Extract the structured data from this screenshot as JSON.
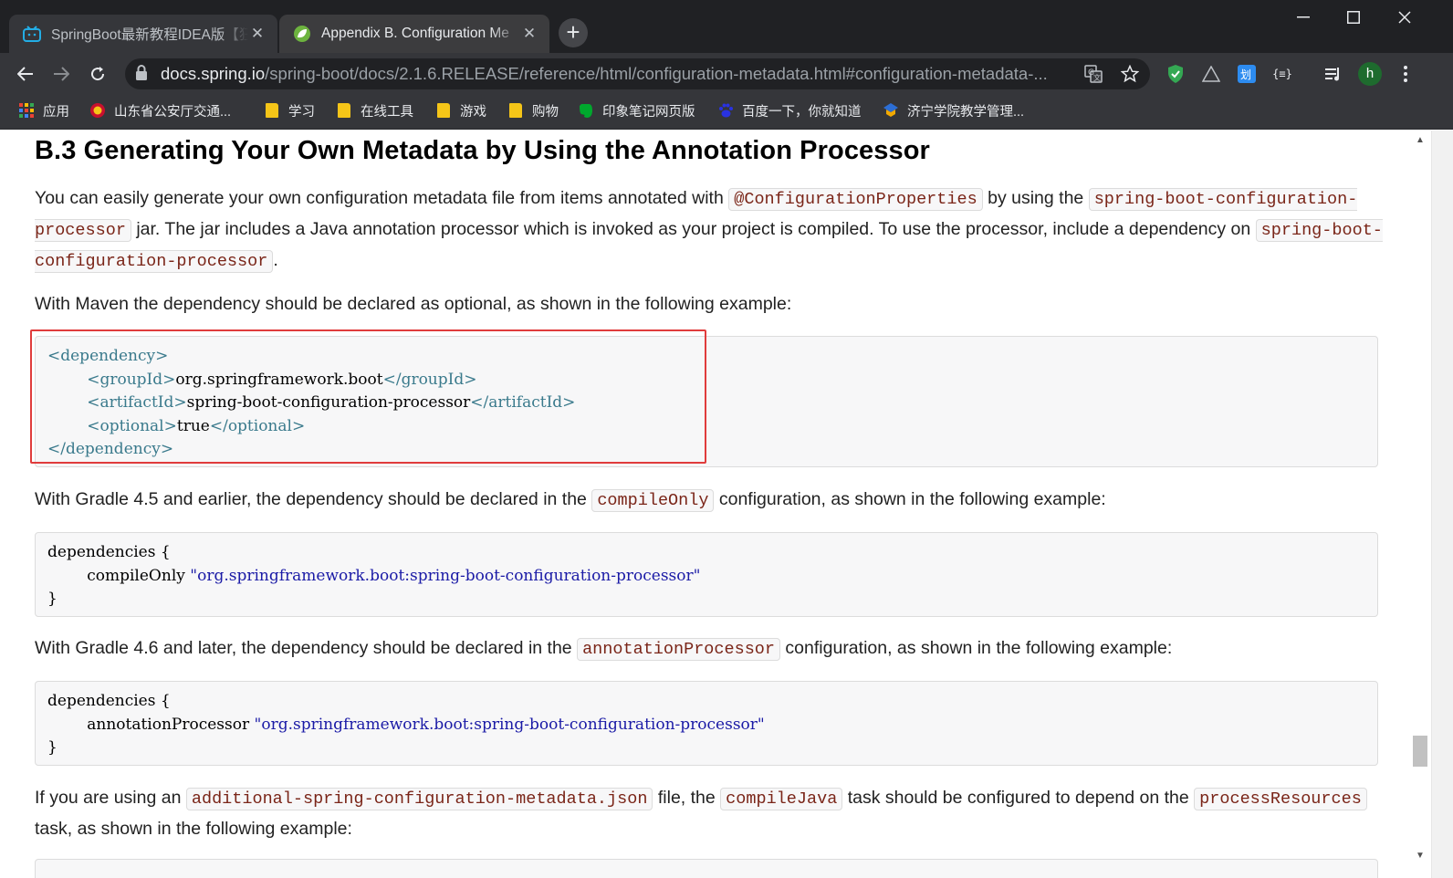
{
  "browser": {
    "tabs": [
      {
        "title": "SpringBoot最新教程IDEA版【狂",
        "active": false,
        "favicon": "bilibili-icon"
      },
      {
        "title": "Appendix B. Configuration Me",
        "active": true,
        "favicon": "spring-leaf-icon"
      }
    ],
    "address": {
      "host": "docs.spring.io",
      "path": "/spring-boot/docs/2.1.6.RELEASE/reference/html/configuration-metadata.html#configuration-metadata-..."
    },
    "avatar_letter": "h",
    "bookmarks": [
      {
        "label": "应用",
        "icon": "apps-grid-icon"
      },
      {
        "label": "山东省公安厅交通...",
        "icon": "police-badge-icon"
      },
      {
        "label": "学习",
        "icon": "folder-icon"
      },
      {
        "label": "在线工具",
        "icon": "folder-icon"
      },
      {
        "label": "游戏",
        "icon": "folder-icon"
      },
      {
        "label": "购物",
        "icon": "folder-icon"
      },
      {
        "label": "印象笔记网页版",
        "icon": "evernote-icon"
      },
      {
        "label": "百度一下，你就知道",
        "icon": "baidu-paw-icon"
      },
      {
        "label": "济宁学院教学管理...",
        "icon": "school-icon"
      }
    ]
  },
  "doc": {
    "heading": "B.3 Generating Your Own Metadata by Using the Annotation Processor",
    "p1": {
      "t1": "You can easily generate your own configuration metadata file from items annotated with ",
      "c1": "@ConfigurationProperties",
      "t2": " by using the ",
      "c2": "spring-boot-configuration-processor",
      "t3": " jar. The jar includes a Java annotation processor which is invoked as your project is compiled. To use the processor, include a dependency on ",
      "c3": "spring-boot-configuration-processor",
      "t4": "."
    },
    "p2": "With Maven the dependency should be declared as optional, as shown in the following example:",
    "maven": {
      "dep_open": "<dependency>",
      "group_open": "<groupId>",
      "group_val": "org.springframework.boot",
      "group_close": "</groupId>",
      "art_open": "<artifactId>",
      "art_val": "spring-boot-configuration-processor",
      "art_close": "</artifactId>",
      "opt_open": "<optional>",
      "opt_val": "true",
      "opt_close": "</optional>",
      "dep_close": "</dependency>"
    },
    "p3": {
      "t1": "With Gradle 4.5 and earlier, the dependency should be declared in the ",
      "c1": "compileOnly",
      "t2": " configuration, as shown in the following example:"
    },
    "gradle45": {
      "l1": "dependencies {",
      "kw": "compileOnly",
      "str": "\"org.springframework.boot:spring-boot-configuration-processor\"",
      "l3": "}"
    },
    "p4": {
      "t1": "With Gradle 4.6 and later, the dependency should be declared in the ",
      "c1": "annotationProcessor",
      "t2": " configuration, as shown in the following example:"
    },
    "gradle46": {
      "l1": "dependencies {",
      "kw": "annotationProcessor",
      "str": "\"org.springframework.boot:spring-boot-configuration-processor\"",
      "l3": "}"
    },
    "p5": {
      "t1": "If you are using an ",
      "c1": "additional-spring-configuration-metadata.json",
      "t2": " file, the ",
      "c2": "compileJava",
      "t3": " task should be configured to depend on the ",
      "c3": "processResources",
      "t4": " task, as shown in the following example:"
    }
  },
  "colors": {
    "highlight_box": "#e03c3c",
    "code_text": "#7a2518",
    "xml_tag": "#3a7a8c",
    "string": "#1a1aa6"
  }
}
